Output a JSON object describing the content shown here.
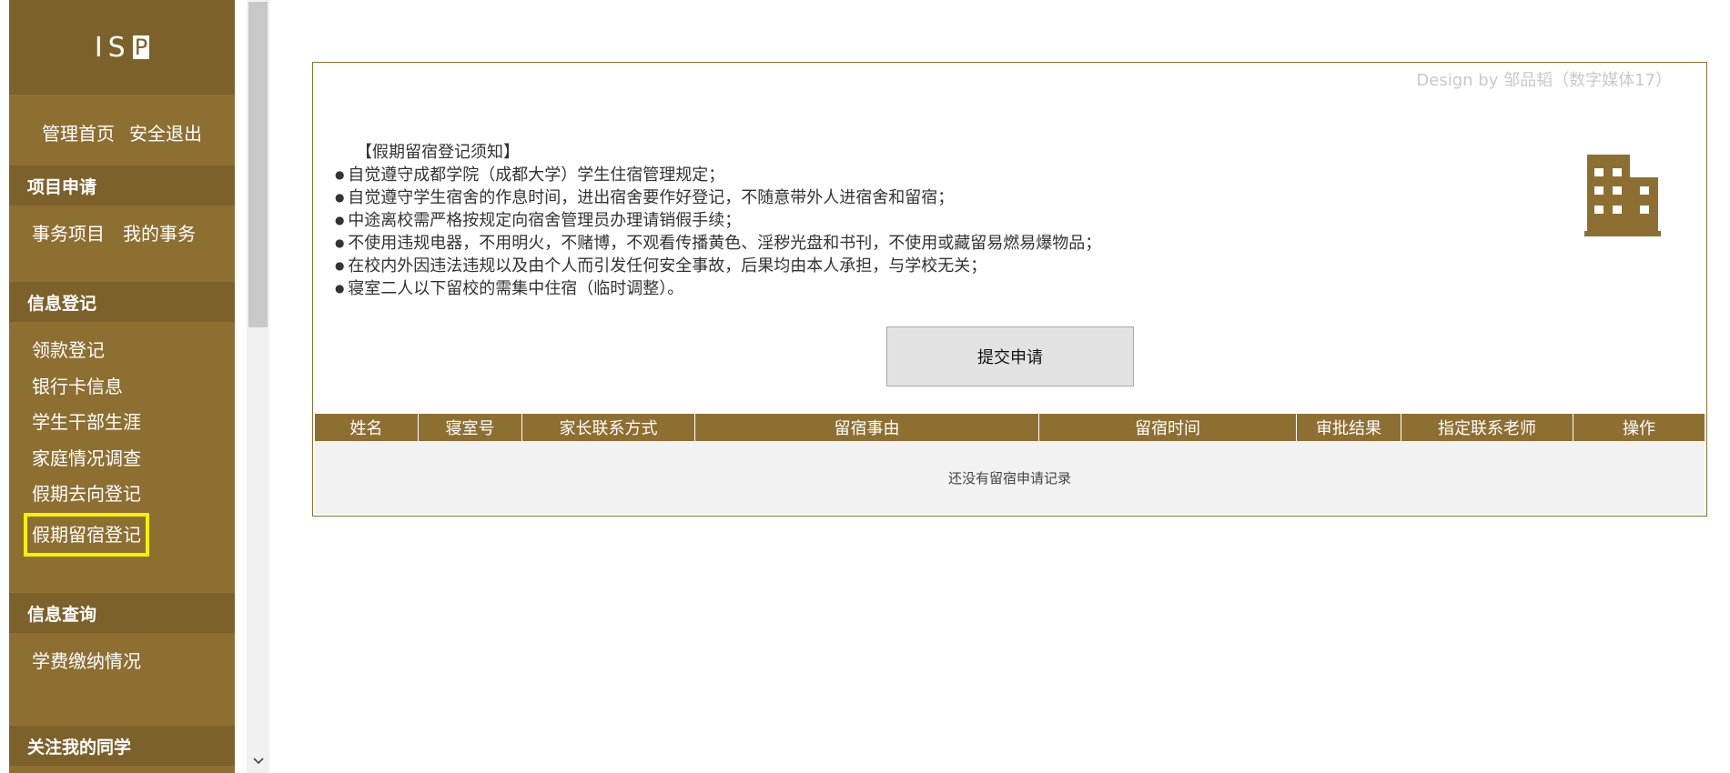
{
  "sidebar": {
    "logo": {
      "prefix": "IS",
      "boxed": "P"
    },
    "top_links": [
      "管理首页",
      "安全退出"
    ],
    "sections": [
      {
        "title": "项目申请",
        "items": [
          "事务项目",
          "我的事务"
        ]
      },
      {
        "title": "信息登记",
        "items": [
          "领款登记",
          "银行卡信息",
          "学生干部生涯",
          "家庭情况调查",
          "假期去向登记",
          "假期留宿登记"
        ]
      },
      {
        "title": "信息查询",
        "items": [
          "学费缴纳情况"
        ]
      },
      {
        "title": "关注我的同学",
        "items": []
      }
    ],
    "selected_item": "假期留宿登记",
    "highlight_color": "#f5f100"
  },
  "main": {
    "credit": "Design by 邹品韬（数字媒体17）",
    "notice_title": "【假期留宿登记须知】",
    "notice_items": [
      "自觉遵守成都学院（成都大学）学生住宿管理规定；",
      "自觉遵守学生宿舍的作息时间，进出宿舍要作好登记，不随意带外人进宿舍和留宿；",
      "中途离校需严格按规定向宿舍管理员办理请销假手续；",
      "不使用违规电器，不用明火，不赌博，不观看传播黄色、淫秽光盘和书刊，不使用或藏留易燃易爆物品；",
      "在校内外因违法违规以及由个人而引发任何安全事故，后果均由本人承担，与学校无关；",
      "寝室二人以下留校的需集中住宿（临时调整）。"
    ],
    "submit_label": "提交申请",
    "table": {
      "columns": [
        "姓名",
        "寝室号",
        "家长联系方式",
        "留宿事由",
        "留宿时间",
        "审批结果",
        "指定联系老师",
        "操作"
      ],
      "empty_text": "还没有留宿申请记录"
    },
    "icon": "building-icon"
  },
  "colors": {
    "brand": "#8e6f32",
    "brand_dark": "#7d612b",
    "table_empty_bg": "#f2f2f2"
  }
}
